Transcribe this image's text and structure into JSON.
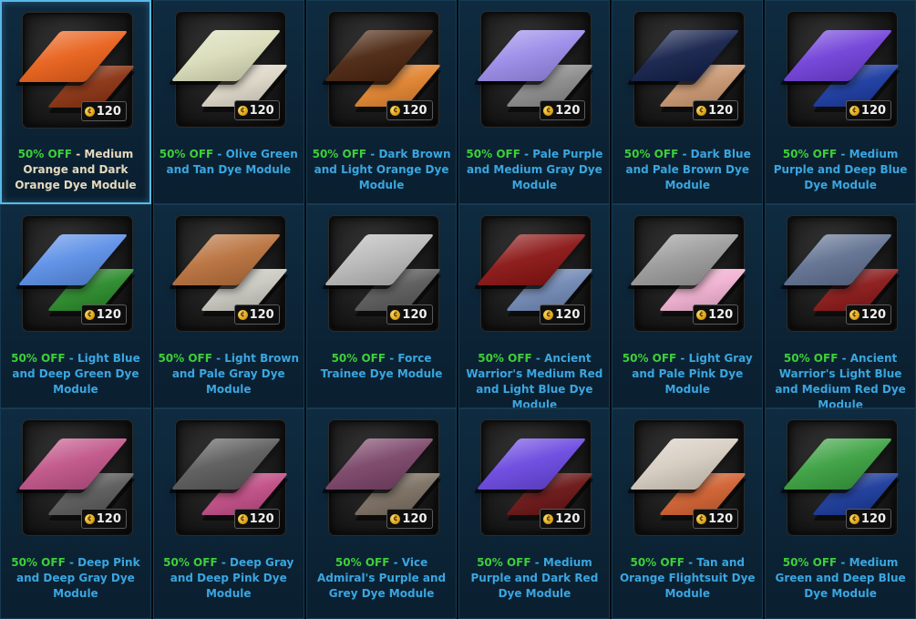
{
  "items": [
    {
      "discount": "50% OFF",
      "separator": " - ",
      "name": "Medium Orange and Dark Orange Dye Module",
      "price": "120",
      "primary": "#e8601a",
      "secondary": "#8a3212",
      "selected": true
    },
    {
      "discount": "50% OFF",
      "separator": " - ",
      "name": "Olive Green and Tan Dye Module",
      "price": "120",
      "primary": "#d9dcb8",
      "secondary": "#dcd6c6",
      "selected": false
    },
    {
      "discount": "50% OFF",
      "separator": " - ",
      "name": "Dark Brown and Light Orange Dye Module",
      "price": "120",
      "primary": "#4a2510",
      "secondary": "#e0822e",
      "selected": false
    },
    {
      "discount": "50% OFF",
      "separator": " - ",
      "name": "Pale Purple and Medium Gray Dye Module",
      "price": "120",
      "primary": "#9a8ae8",
      "secondary": "#8a8a8a",
      "selected": false
    },
    {
      "discount": "50% OFF",
      "separator": " - ",
      "name": "Dark Blue and Pale Brown Dye Module",
      "price": "120",
      "primary": "#14204a",
      "secondary": "#c89670",
      "selected": false
    },
    {
      "discount": "50% OFF",
      "separator": " - ",
      "name": "Medium Purple and Deep Blue Dye Module",
      "price": "120",
      "primary": "#7040d8",
      "secondary": "#1a3aa0",
      "selected": false
    },
    {
      "discount": "50% OFF",
      "separator": " - ",
      "name": "Light Blue and Deep Green Dye Module",
      "price": "120",
      "primary": "#5a8ee6",
      "secondary": "#2a8a2a",
      "selected": false
    },
    {
      "discount": "50% OFF",
      "separator": " - ",
      "name": "Light Brown and Pale Gray Dye Module",
      "price": "120",
      "primary": "#b8703c",
      "secondary": "#c8c8c0",
      "selected": false
    },
    {
      "discount": "50% OFF",
      "separator": " - ",
      "name": "Force Trainee Dye Module",
      "price": "120",
      "primary": "#b8b8b8",
      "secondary": "#5a5a5a",
      "selected": false
    },
    {
      "discount": "50% OFF",
      "separator": " - ",
      "name": "Ancient Warrior's Medium Red and Light Blue Dye Module",
      "price": "120",
      "primary": "#8a1414",
      "secondary": "#7088b4",
      "selected": false
    },
    {
      "discount": "50% OFF",
      "separator": " - ",
      "name": "Light Gray and Pale Pink Dye Module",
      "price": "120",
      "primary": "#9a9a9a",
      "secondary": "#f0b0d0",
      "selected": false
    },
    {
      "discount": "50% OFF",
      "separator": " - ",
      "name": "Ancient Warrior's Light Blue and Medium Red Dye Module",
      "price": "120",
      "primary": "#607090",
      "secondary": "#8a1818",
      "selected": false
    },
    {
      "discount": "50% OFF",
      "separator": " - ",
      "name": "Deep Pink and Deep Gray Dye Module",
      "price": "120",
      "primary": "#c05488",
      "secondary": "#5a5a5a",
      "selected": false
    },
    {
      "discount": "50% OFF",
      "separator": " - ",
      "name": "Deep Gray and Deep Pink Dye Module",
      "price": "120",
      "primary": "#5a5a5a",
      "secondary": "#c04c84",
      "selected": false
    },
    {
      "discount": "50% OFF",
      "separator": " - ",
      "name": "Vice Admiral's Purple and Grey Dye Module",
      "price": "120",
      "primary": "#7a4468",
      "secondary": "#7a6e60",
      "selected": false
    },
    {
      "discount": "50% OFF",
      "separator": " - ",
      "name": "Medium Purple and Dark Red Dye Module",
      "price": "120",
      "primary": "#6a48e0",
      "secondary": "#6a1414",
      "selected": false
    },
    {
      "discount": "50% OFF",
      "separator": " - ",
      "name": "Tan and Orange Flightsuit Dye Module",
      "price": "120",
      "primary": "#d6ccc0",
      "secondary": "#d06030",
      "selected": false
    },
    {
      "discount": "50% OFF",
      "separator": " - ",
      "name": "Medium Green and Deep Blue Dye Module",
      "price": "120",
      "primary": "#3aa040",
      "secondary": "#1a3a9a",
      "selected": false
    }
  ]
}
